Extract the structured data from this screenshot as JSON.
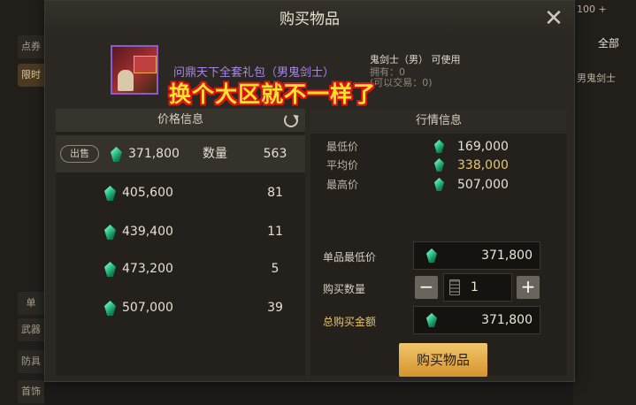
{
  "background": {
    "left_tabs": [
      "点券",
      "限时",
      "",
      "",
      "单",
      "武器",
      "防具",
      "首饰"
    ],
    "right_items": [
      "100 +",
      "全部",
      "男鬼剑士"
    ]
  },
  "dialog": {
    "title": "购买物品",
    "close_glyph": "✕"
  },
  "item": {
    "name": "问鼎天下全套礼包（男鬼剑士）",
    "usable_by": "鬼剑士（男） 可使用",
    "owned": "拥有：0",
    "tradable": "(可以交易：0)"
  },
  "overlay_caption": "换个大区就不一样了",
  "price_panel": {
    "title": "价格信息",
    "sell_tag": "出售",
    "quantity_label": "数量",
    "rows": [
      {
        "price": "371,800",
        "quantity": "563"
      },
      {
        "price": "405,600",
        "quantity": "81"
      },
      {
        "price": "439,400",
        "quantity": "11"
      },
      {
        "price": "473,200",
        "quantity": "5"
      },
      {
        "price": "507,000",
        "quantity": "39"
      }
    ]
  },
  "market_panel": {
    "title": "行情信息",
    "lowest_label": "最低价",
    "lowest_value": "169,000",
    "average_label": "平均价",
    "average_value": "338,000",
    "highest_label": "最高价",
    "highest_value": "507,000"
  },
  "purchase_form": {
    "unit_price_label": "单品最低价",
    "unit_price": "371,800",
    "quantity_label": "购买数量",
    "quantity": "1",
    "minus": "−",
    "plus": "+",
    "total_label": "总购买金额",
    "total": "371,800",
    "buy_button": "购买物品"
  },
  "colors": {
    "item_name": "#a886e8",
    "gold_text": "#e8c46a",
    "gem": "#3fd49a",
    "buy_button": "#e0a843",
    "overlay_text": "#ffe02a",
    "overlay_outline": "#d81414"
  }
}
